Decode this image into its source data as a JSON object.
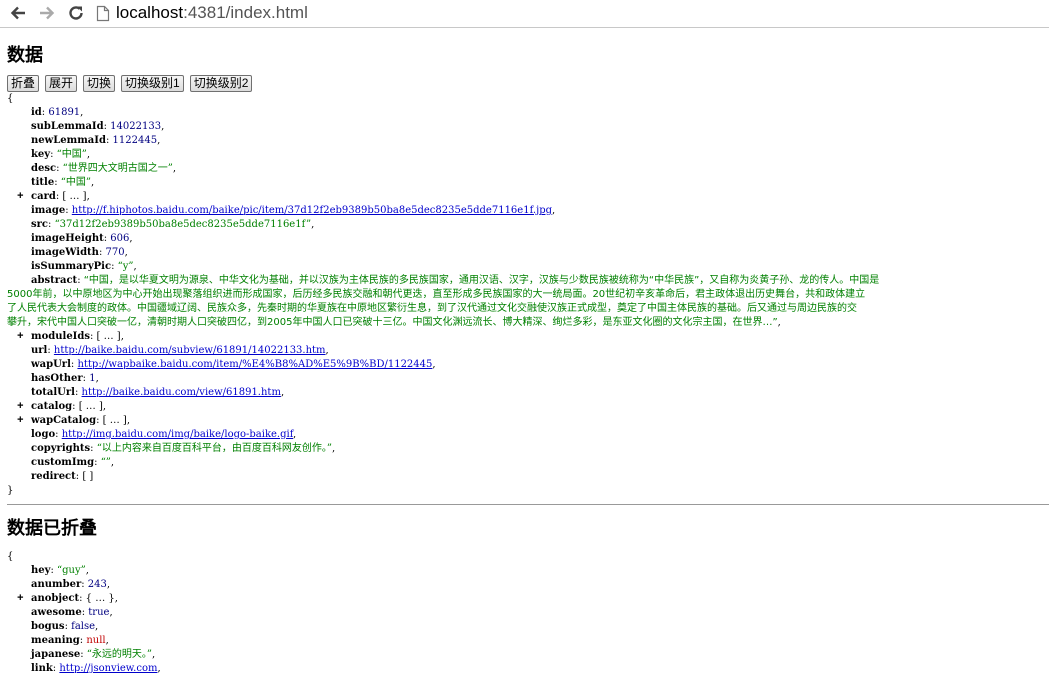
{
  "browser": {
    "url_host": "localhost",
    "url_port": ":4381",
    "url_path": "/index.html"
  },
  "section1": {
    "title": "数据",
    "buttons": [
      "折叠",
      "展开",
      "切换",
      "切换级别1",
      "切换级别2"
    ]
  },
  "json1": {
    "open": "{",
    "close": "}",
    "rows": [
      {
        "key": "id",
        "val": "61891",
        "type": "n"
      },
      {
        "key": "subLemmaId",
        "val": "14022133",
        "type": "n"
      },
      {
        "key": "newLemmaId",
        "val": "1122445",
        "type": "n"
      },
      {
        "key": "key",
        "val": "“中国”",
        "type": "s"
      },
      {
        "key": "desc",
        "val": "“世界四大文明古国之一”",
        "type": "s"
      },
      {
        "key": "title",
        "val": "“中国”",
        "type": "s"
      },
      {
        "key": "card",
        "val": "[ … ]",
        "type": "c"
      },
      {
        "key": "image",
        "val": "http://f.hiphotos.baidu.com/baike/pic/item/37d12f2eb9389b50ba8e5dec8235e5dde7116e1f.jpg",
        "type": "a"
      },
      {
        "key": "src",
        "val": "“37d12f2eb9389b50ba8e5dec8235e5dde7116e1f”",
        "type": "s"
      },
      {
        "key": "imageHeight",
        "val": "606",
        "type": "n"
      },
      {
        "key": "imageWidth",
        "val": "770",
        "type": "n"
      },
      {
        "key": "isSummaryPic",
        "val": "“y”",
        "type": "s"
      }
    ],
    "abstract_key": "abstract",
    "abstract_lines": [
      "“中国，是以华夏文明为源泉、中华文化为基础，并以汉族为主体民族的多民族国家，通用汉语、汉字，汉族与少数民族被统称为“中华民族”，又自称为炎黄子孙、龙的传人。中国是",
      "5000年前，以中原地区为中心开始出现聚落组织进而形成国家，后历经多民族交融和朝代更迭，直至形成多民族国家的大一统局面。20世纪初辛亥革命后，君主政体退出历史舞台，共和政体建立",
      "了人民代表大会制度的政体。中国疆域辽阔、民族众多，先秦时期的华夏族在中原地区繁衍生息，到了汉代通过文化交融使汉族正式成型，奠定了中国主体民族的基础。后又通过与周边民族的交",
      "攀升，宋代中国人口突破一亿，清朝时期人口突破四亿，到2005年中国人口已突破十三亿。中国文化渊远流长、博大精深、绚烂多彩，是东亚文化圈的文化宗主国，在世界…”"
    ],
    "rows2": [
      {
        "key": "moduleIds",
        "val": "[ … ]",
        "type": "c"
      },
      {
        "key": "url",
        "val": "http://baike.baidu.com/subview/61891/14022133.htm",
        "type": "a"
      },
      {
        "key": "wapUrl",
        "val": "http://wapbaike.baidu.com/item/%E4%B8%AD%E5%9B%BD/1122445",
        "type": "a"
      },
      {
        "key": "hasOther",
        "val": "1",
        "type": "n"
      },
      {
        "key": "totalUrl",
        "val": "http://baike.baidu.com/view/61891.htm",
        "type": "a"
      },
      {
        "key": "catalog",
        "val": "[ … ]",
        "type": "c"
      },
      {
        "key": "wapCatalog",
        "val": "[ … ]",
        "type": "c"
      },
      {
        "key": "logo",
        "val": "http://img.baidu.com/img/baike/logo-baike.gif",
        "type": "a"
      },
      {
        "key": "copyrights",
        "val": "“以上内容来自百度百科平台，由百度百科网友创作。”",
        "type": "s"
      },
      {
        "key": "customImg",
        "val": "“”",
        "type": "s"
      },
      {
        "key": "redirect",
        "val": "[ ]",
        "type": "e",
        "last": true
      }
    ]
  },
  "section2": {
    "title": "数据已折叠"
  },
  "json2": {
    "open": "{",
    "rows": [
      {
        "key": "hey",
        "val": "“guy”",
        "type": "s"
      },
      {
        "key": "anumber",
        "val": "243",
        "type": "n"
      },
      {
        "key": "anobject",
        "val": "{ … }",
        "type": "c"
      },
      {
        "key": "awesome",
        "val": "true",
        "type": "b"
      },
      {
        "key": "bogus",
        "val": "false",
        "type": "b"
      },
      {
        "key": "meaning",
        "val": "null",
        "type": "nul"
      },
      {
        "key": "japanese",
        "val": "“永远的明天。”",
        "type": "s"
      },
      {
        "key": "link",
        "val": "http://jsonview.com",
        "type": "a"
      }
    ]
  }
}
